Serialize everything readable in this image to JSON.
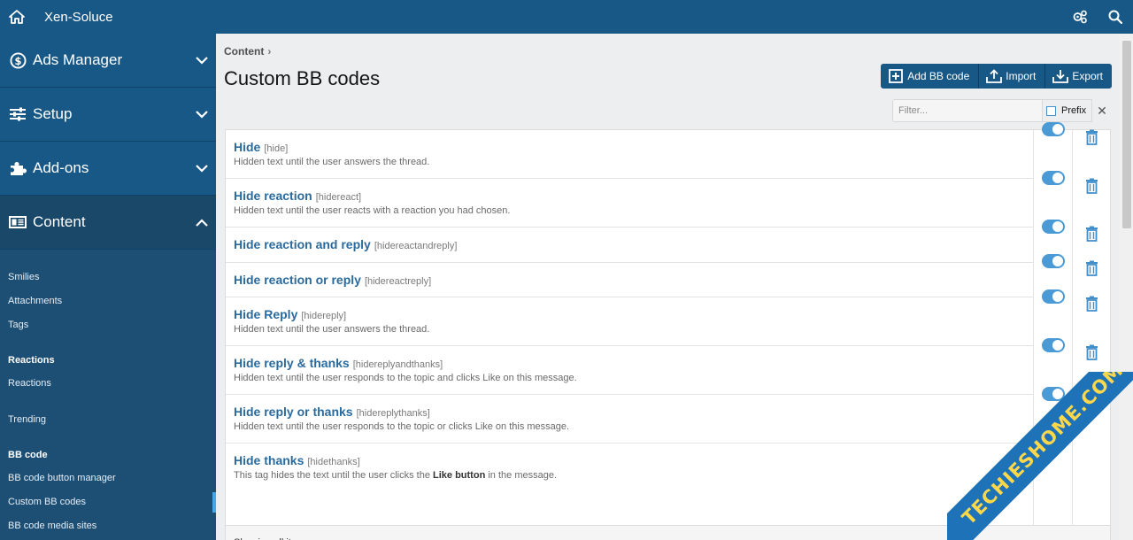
{
  "topbar": {
    "brand": "Xen-Soluce",
    "home_icon": "home-icon",
    "settings_icon": "gears-icon",
    "search_icon": "search-icon"
  },
  "sidebar": {
    "sections": [
      {
        "label": "Ads Manager",
        "icon": "dollar-circle-icon",
        "expanded": false
      },
      {
        "label": "Setup",
        "icon": "sliders-icon",
        "expanded": false
      },
      {
        "label": "Add-ons",
        "icon": "puzzle-icon",
        "expanded": false
      },
      {
        "label": "Content",
        "icon": "image-list-icon",
        "expanded": true
      }
    ],
    "content_items": [
      {
        "label": "Smilies"
      },
      {
        "label": "Attachments"
      },
      {
        "label": "Tags"
      }
    ],
    "reactions_head": "Reactions",
    "reactions_items": [
      {
        "label": "Reactions"
      }
    ],
    "trending": "Trending",
    "bbcode_head": "BB code",
    "bbcode_items": [
      {
        "label": "BB code button manager"
      },
      {
        "label": "Custom BB codes",
        "current": true
      },
      {
        "label": "BB code media sites"
      }
    ]
  },
  "breadcrumb": {
    "label": "Content",
    "chevron": "›"
  },
  "page": {
    "title": "Custom BB codes"
  },
  "actions": {
    "add": "Add BB code",
    "import": "Import",
    "export": "Export"
  },
  "filter": {
    "placeholder": "Filter...",
    "prefix": "Prefix",
    "clear": "✕"
  },
  "items": [
    {
      "title": "Hide",
      "tag": "[hide]",
      "desc": "Hidden text until the user answers the thread.",
      "enabled": true
    },
    {
      "title": "Hide reaction",
      "tag": "[hidereact]",
      "desc": "Hidden text until the user reacts with a reaction you had chosen.",
      "enabled": true
    },
    {
      "title": "Hide reaction and reply",
      "tag": "[hidereactandreply]",
      "desc": "",
      "enabled": true
    },
    {
      "title": "Hide reaction or reply",
      "tag": "[hidereactreply]",
      "desc": "",
      "enabled": true
    },
    {
      "title": "Hide Reply",
      "tag": "[hidereply]",
      "desc": "Hidden text until the user answers the thread.",
      "enabled": true
    },
    {
      "title": "Hide reply & thanks",
      "tag": "[hidereplyandthanks]",
      "desc": "Hidden text until the user responds to the topic and clicks Like on this message.",
      "enabled": true
    },
    {
      "title": "Hide reply or thanks",
      "tag": "[hidereplythanks]",
      "desc": "Hidden text until the user responds to the topic or clicks Like on this message.",
      "enabled": true
    },
    {
      "title": "Hide thanks",
      "tag": "[hidethanks]",
      "desc_pre": "This tag hides the text until the user clicks the ",
      "desc_bold": "Like button",
      "desc_post": " in the message.",
      "enabled": true
    }
  ],
  "footer": {
    "text": "Showing all items"
  },
  "watermark": {
    "text": "TECHIESHOME.COM"
  },
  "colors": {
    "topbar": "#185886",
    "sidebar": "#1d4e74",
    "link": "#2a6a9c",
    "toggle": "#4a9ad6"
  }
}
